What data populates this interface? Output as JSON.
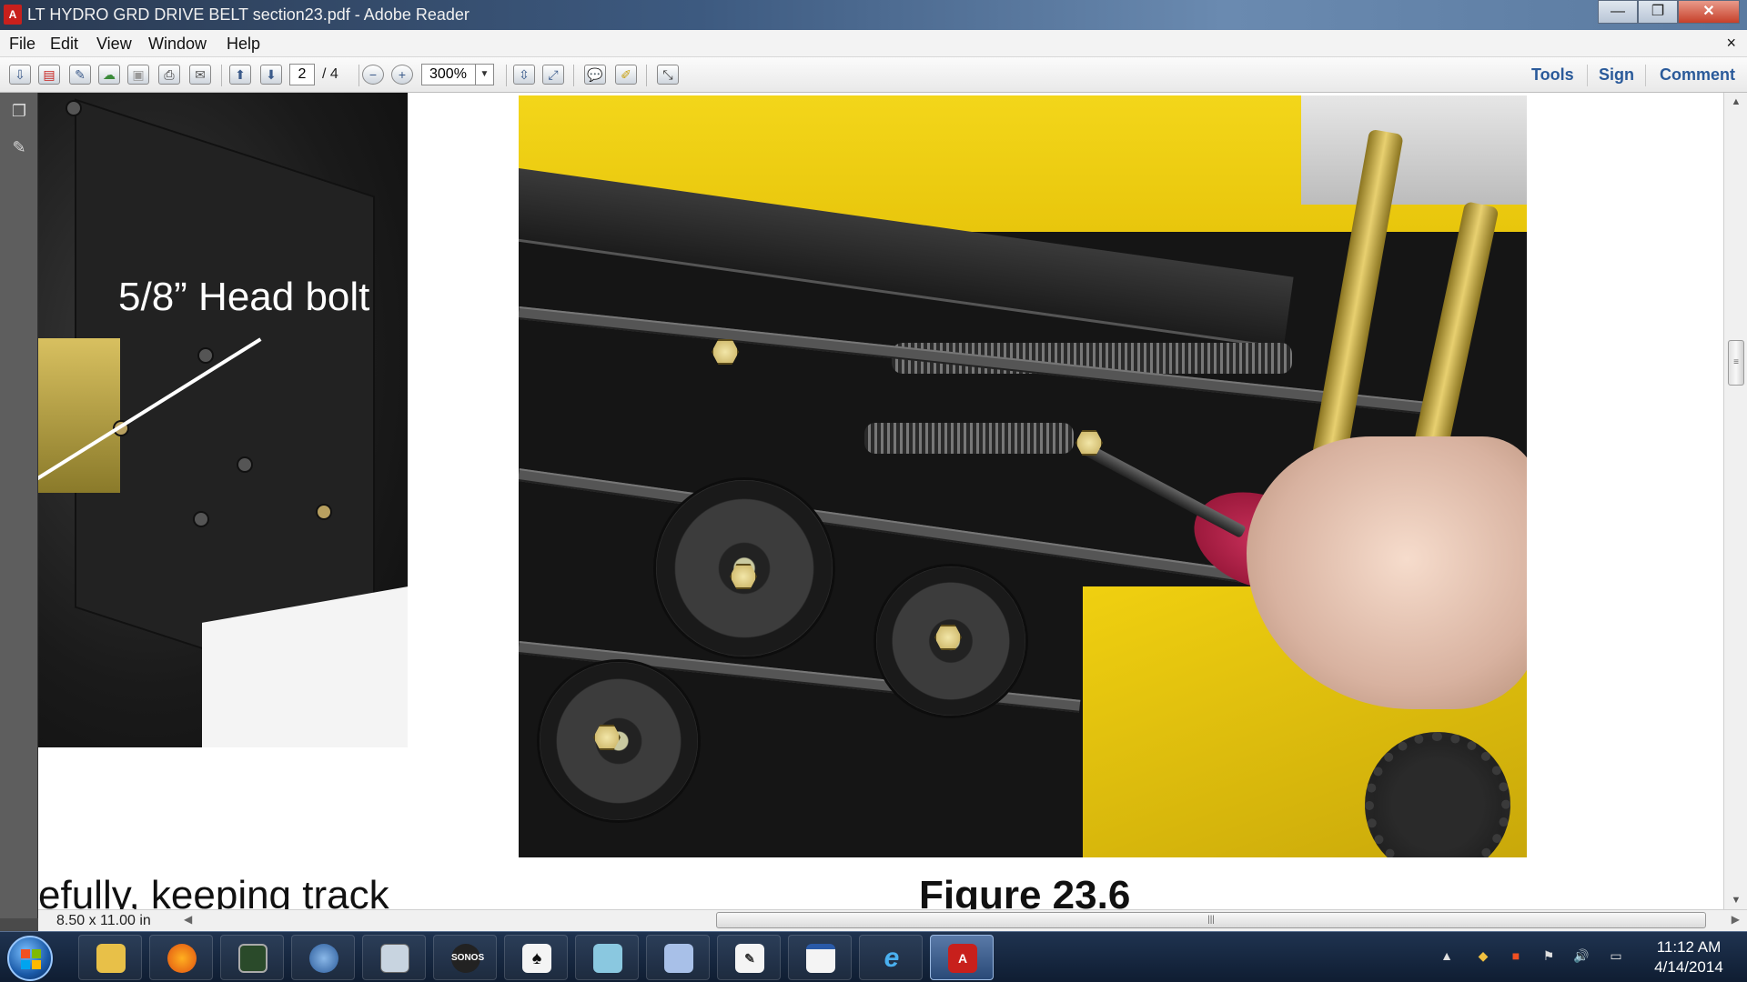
{
  "window": {
    "title": "LT HYDRO GRD DRIVE BELT section23.pdf - Adobe Reader",
    "app_icon": "adobe-reader-icon"
  },
  "menu": {
    "items": [
      "File",
      "Edit",
      "View",
      "Window",
      "Help"
    ],
    "close_glyph": "×"
  },
  "toolbar": {
    "current_page": "2",
    "total_pages": "/ 4",
    "zoom": "300%",
    "links": [
      "Tools",
      "Sign",
      "Comment"
    ]
  },
  "document": {
    "label_headbolt": "5/8” Head bolt",
    "figure_caption": "Figure 23.6",
    "body_text": "efully, keeping track"
  },
  "statusbar": {
    "page_size": "8.50 x 11.00 in"
  },
  "taskbar": {
    "apps": [
      "File Explorer",
      "Firefox",
      "Task Manager",
      "Thunderbird",
      "Calculator",
      "Sonos",
      "Solitaire",
      "Notepad",
      "Paint",
      "WordPad",
      "Calendar",
      "Internet Explorer",
      "Adobe Reader"
    ],
    "sonos_label": "SONOS",
    "time": "11:12 AM",
    "date": "4/14/2014"
  },
  "colors": {
    "titlebar": "#3d5a80",
    "toolbar_link": "#2a5a9a",
    "machine_yellow": "#f3d61a",
    "adobe_red": "#c8201c"
  }
}
